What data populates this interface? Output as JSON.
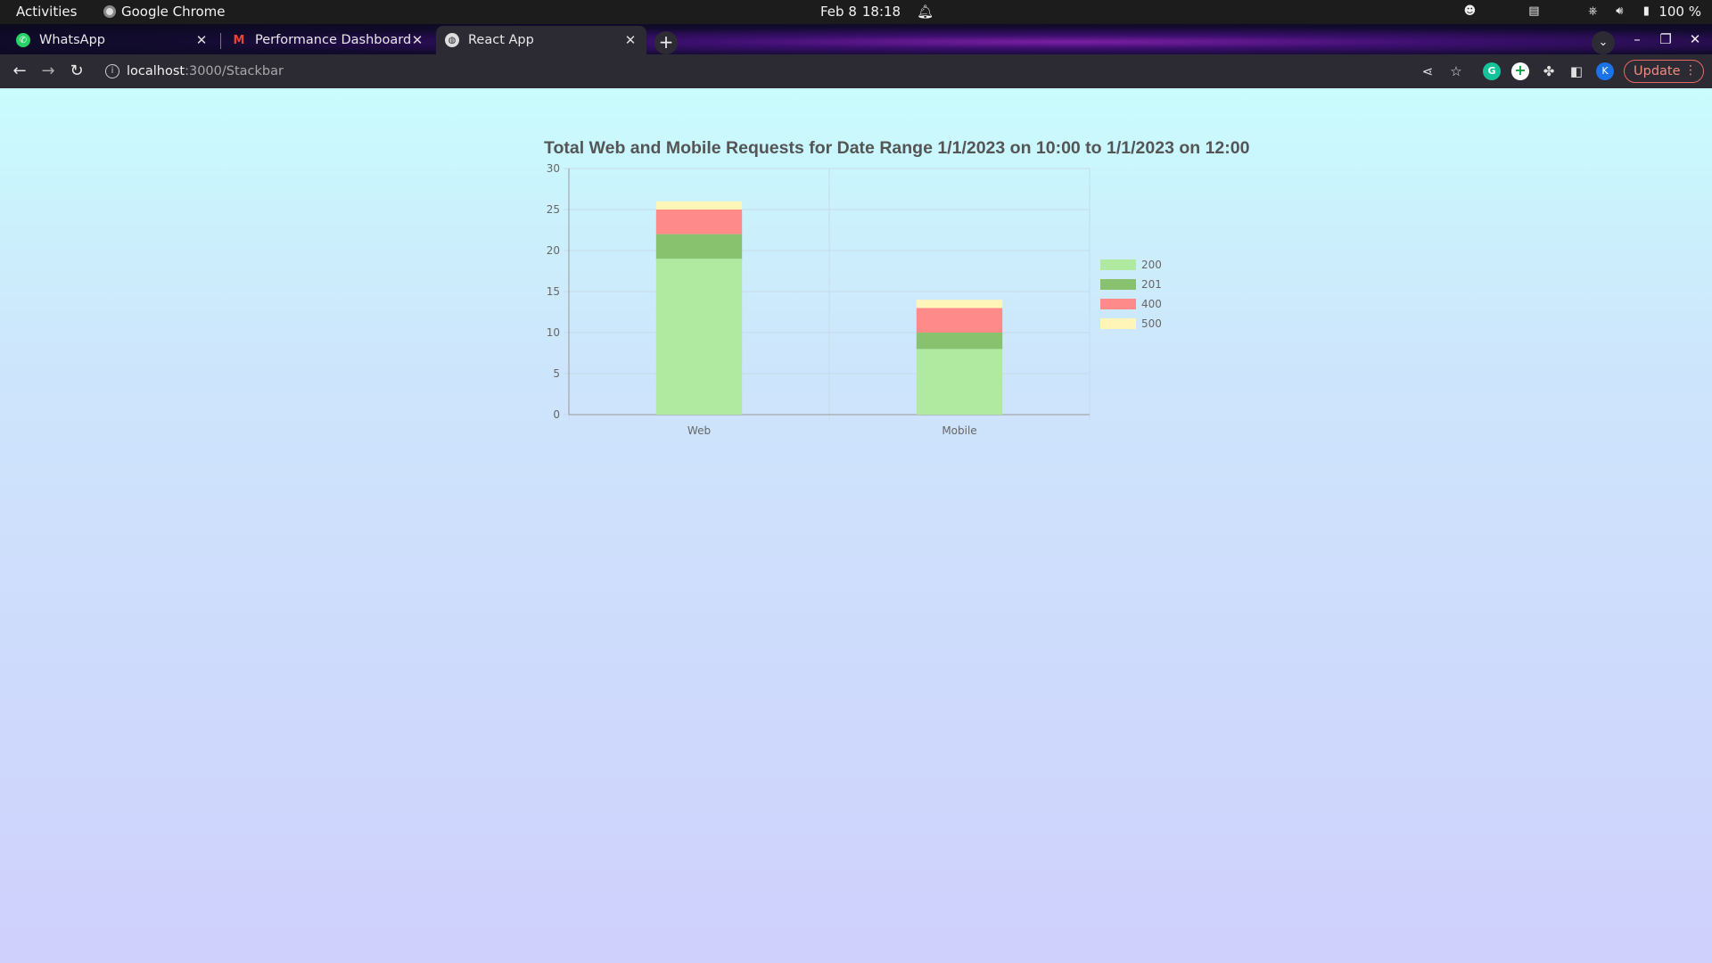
{
  "topbar": {
    "activities": "Activities",
    "app_name": "Google Chrome",
    "date": "Feb 8",
    "time": "18:18",
    "battery": "100 %"
  },
  "tabs": [
    {
      "title": "WhatsApp",
      "icon": "whatsapp-icon",
      "color": "#25d366"
    },
    {
      "title": "Performance Dashboard",
      "icon": "gmail-icon",
      "color": "#ea4335"
    },
    {
      "title": "React App",
      "icon": "globe-icon",
      "color": "#dddddd"
    }
  ],
  "toolbar": {
    "url_host": "localhost",
    "url_path": ":3000/Stackbar",
    "update_label": "Update"
  },
  "colors": {
    "s200": "#b0e9a0",
    "s201": "#88c26f",
    "s400": "#ff8a8a",
    "s500": "#fff5b8",
    "grid": "#c6dbe8",
    "axis": "#999999"
  },
  "chart_data": {
    "type": "bar",
    "stacked": true,
    "title": "Total Web and Mobile Requests for Date Range 1/1/2023 on 10:00 to 1/1/2023 on 12:00",
    "categories": [
      "Web",
      "Mobile"
    ],
    "series": [
      {
        "name": "200",
        "values": [
          19,
          8
        ],
        "color": "#b0e9a0"
      },
      {
        "name": "201",
        "values": [
          3,
          2
        ],
        "color": "#88c26f"
      },
      {
        "name": "400",
        "values": [
          3,
          3
        ],
        "color": "#ff8a8a"
      },
      {
        "name": "500",
        "values": [
          1,
          1
        ],
        "color": "#fff5b8"
      }
    ],
    "ylim": [
      0,
      30
    ],
    "yticks": [
      "0",
      "5",
      "10",
      "15",
      "20",
      "25",
      "30"
    ],
    "grid": true,
    "legend_position": "right"
  }
}
